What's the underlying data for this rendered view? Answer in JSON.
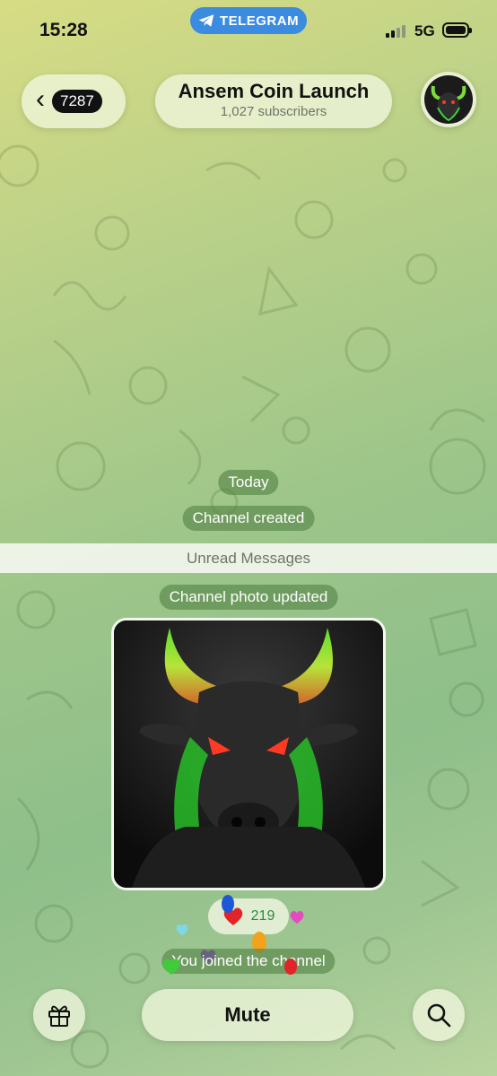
{
  "status_bar": {
    "time": "15:28",
    "app_pill": "TELEGRAM",
    "network": "5G",
    "signal_bars_filled": 2,
    "signal_bars_total": 4,
    "battery_level": 1.0
  },
  "header": {
    "back_count": "7287",
    "title": "Ansem Coin Launch",
    "subtitle": "1,027 subscribers"
  },
  "messages": {
    "date_label": "Today",
    "channel_created": "Channel created",
    "unread_divider": "Unread Messages",
    "photo_updated": "Channel photo updated",
    "reaction_emoji": "heart",
    "reaction_count": "219",
    "joined": "You joined the channel"
  },
  "bottom_bar": {
    "gift_icon": "gift-icon",
    "mute_label": "Mute",
    "search_icon": "search-icon"
  },
  "colors": {
    "service_bubble": "#548246",
    "accent_blue": "#3b8be0",
    "reaction_count": "#2f8a3f",
    "heart_red": "#e0242a"
  }
}
